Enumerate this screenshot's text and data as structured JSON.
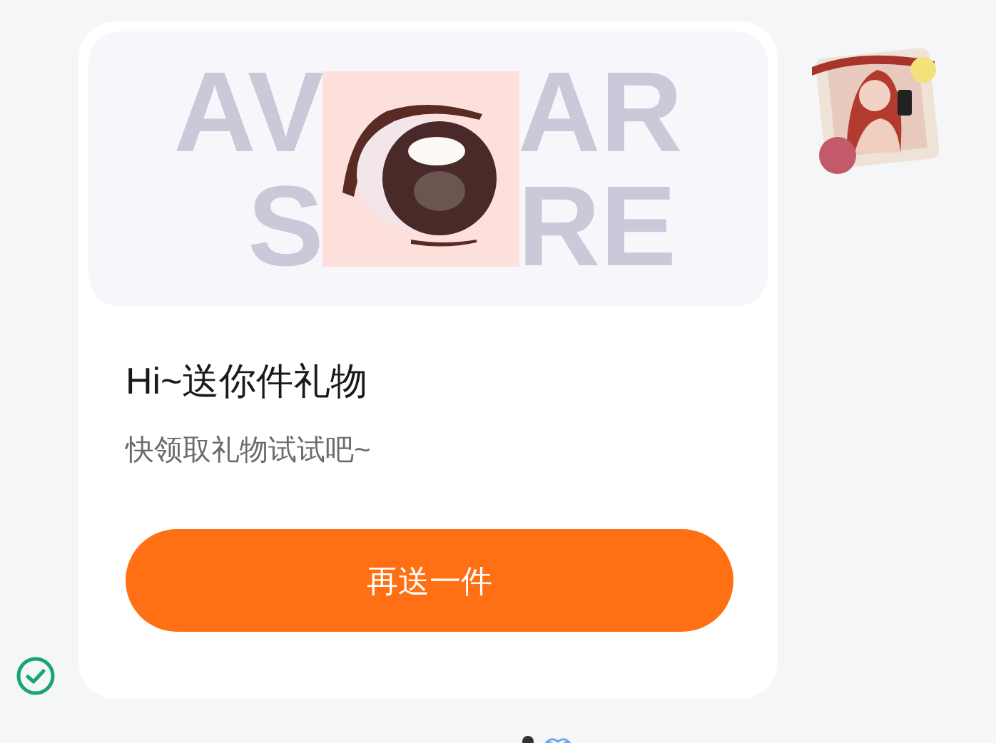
{
  "message": {
    "wordmark": [
      "AV",
      "AR",
      "S",
      "RE"
    ],
    "title": "Hi~送你件礼物",
    "subtitle": "快领取礼物试试吧~",
    "button": "再送一件",
    "delivered": true
  }
}
